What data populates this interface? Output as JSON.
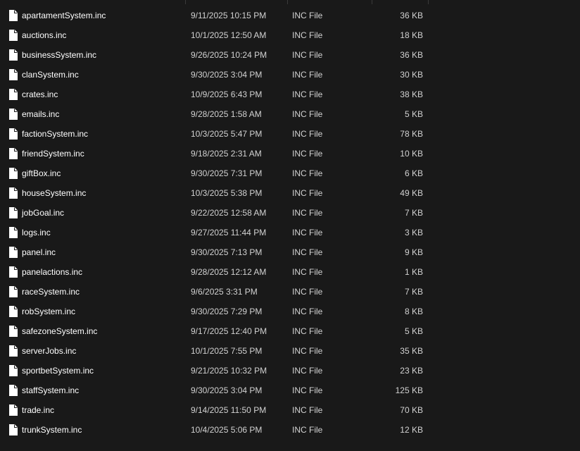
{
  "colors": {
    "background": "#191919",
    "name_text": "#ffffff",
    "meta_text": "#d2d2d2",
    "column_separator": "#3a3a3a"
  },
  "file_icon": "document-icon",
  "files": [
    {
      "name": "apartamentSystem.inc",
      "date": "9/11/2025 10:15 PM",
      "type": "INC File",
      "size": "36 KB"
    },
    {
      "name": "auctions.inc",
      "date": "10/1/2025 12:50 AM",
      "type": "INC File",
      "size": "18 KB"
    },
    {
      "name": "businessSystem.inc",
      "date": "9/26/2025 10:24 PM",
      "type": "INC File",
      "size": "36 KB"
    },
    {
      "name": "clanSystem.inc",
      "date": "9/30/2025 3:04 PM",
      "type": "INC File",
      "size": "30 KB"
    },
    {
      "name": "crates.inc",
      "date": "10/9/2025 6:43 PM",
      "type": "INC File",
      "size": "38 KB"
    },
    {
      "name": "emails.inc",
      "date": "9/28/2025 1:58 AM",
      "type": "INC File",
      "size": "5 KB"
    },
    {
      "name": "factionSystem.inc",
      "date": "10/3/2025 5:47 PM",
      "type": "INC File",
      "size": "78 KB"
    },
    {
      "name": "friendSystem.inc",
      "date": "9/18/2025 2:31 AM",
      "type": "INC File",
      "size": "10 KB"
    },
    {
      "name": "giftBox.inc",
      "date": "9/30/2025 7:31 PM",
      "type": "INC File",
      "size": "6 KB"
    },
    {
      "name": "houseSystem.inc",
      "date": "10/3/2025 5:38 PM",
      "type": "INC File",
      "size": "49 KB"
    },
    {
      "name": "jobGoal.inc",
      "date": "9/22/2025 12:58 AM",
      "type": "INC File",
      "size": "7 KB"
    },
    {
      "name": "logs.inc",
      "date": "9/27/2025 11:44 PM",
      "type": "INC File",
      "size": "3 KB"
    },
    {
      "name": "panel.inc",
      "date": "9/30/2025 7:13 PM",
      "type": "INC File",
      "size": "9 KB"
    },
    {
      "name": "panelactions.inc",
      "date": "9/28/2025 12:12 AM",
      "type": "INC File",
      "size": "1 KB"
    },
    {
      "name": "raceSystem.inc",
      "date": "9/6/2025 3:31 PM",
      "type": "INC File",
      "size": "7 KB"
    },
    {
      "name": "robSystem.inc",
      "date": "9/30/2025 7:29 PM",
      "type": "INC File",
      "size": "8 KB"
    },
    {
      "name": "safezoneSystem.inc",
      "date": "9/17/2025 12:40 PM",
      "type": "INC File",
      "size": "5 KB"
    },
    {
      "name": "serverJobs.inc",
      "date": "10/1/2025 7:55 PM",
      "type": "INC File",
      "size": "35 KB"
    },
    {
      "name": "sportbetSystem.inc",
      "date": "9/21/2025 10:32 PM",
      "type": "INC File",
      "size": "23 KB"
    },
    {
      "name": "staffSystem.inc",
      "date": "9/30/2025 3:04 PM",
      "type": "INC File",
      "size": "125 KB"
    },
    {
      "name": "trade.inc",
      "date": "9/14/2025 11:50 PM",
      "type": "INC File",
      "size": "70 KB"
    },
    {
      "name": "trunkSystem.inc",
      "date": "10/4/2025 5:06 PM",
      "type": "INC File",
      "size": "12 KB"
    }
  ]
}
